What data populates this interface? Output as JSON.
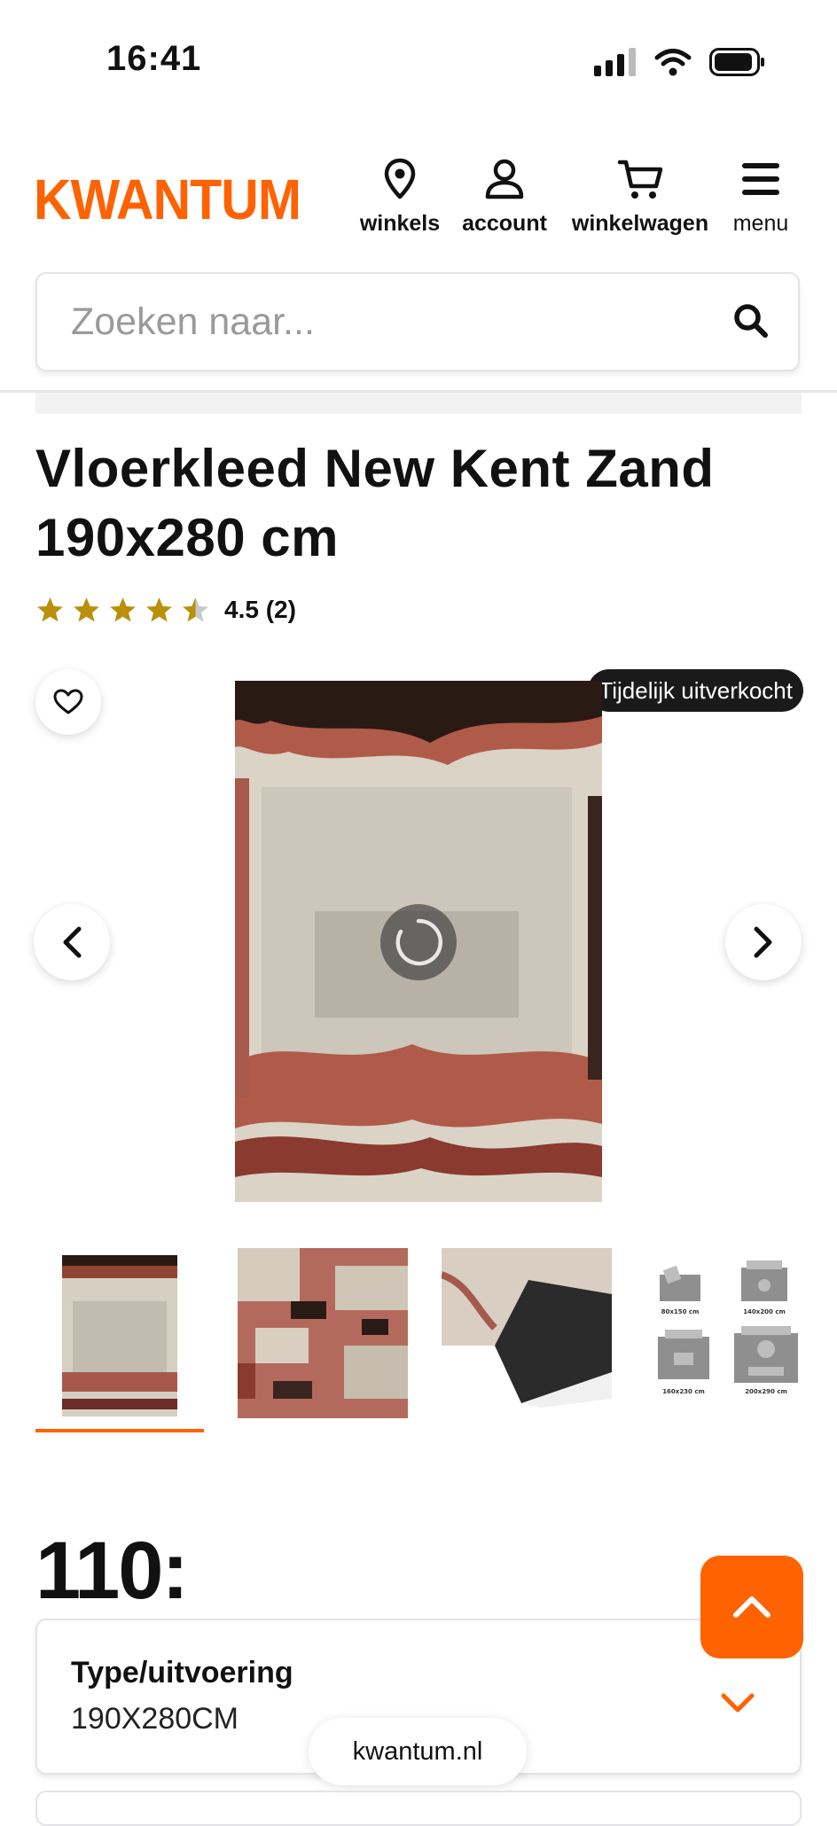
{
  "status_bar": {
    "time": "16:41"
  },
  "header": {
    "logo": "KWANTUM",
    "nav": {
      "stores": "winkels",
      "account": "account",
      "cart": "winkelwagen",
      "menu": "menu"
    }
  },
  "search": {
    "placeholder": "Zoeken naar..."
  },
  "product": {
    "title_line1": "Vloerkleed New Kent Zand",
    "title_line2": "190x280 cm",
    "rating_value": 4.5,
    "rating_text": "4.5 (2)",
    "badge": "Tijdelijk uitverkocht",
    "price": "110:",
    "option_label": "Type/uitvoering",
    "option_value": "190X280CM"
  },
  "gallery": {
    "thumbnails": [
      {
        "icon": "rug-overview"
      },
      {
        "icon": "rug-texture-closeup"
      },
      {
        "icon": "rug-backside"
      },
      {
        "icon": "room-size-diagram",
        "sizes": [
          "80x150 cm",
          "140x200 cm",
          "160x230 cm",
          "200x290 cm"
        ]
      }
    ],
    "active_index": 0
  },
  "footer": {
    "url": "kwantum.nl"
  },
  "colors": {
    "brand": "#ff6200",
    "star": "#b8900a",
    "badge_bg": "#1a1a1a"
  }
}
